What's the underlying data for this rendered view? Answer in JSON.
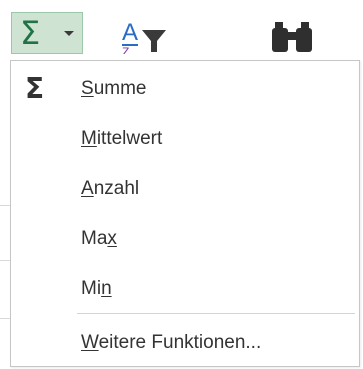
{
  "ribbon": {
    "autosum_symbol": "Σ",
    "autosum_icon": "sigma-icon",
    "sort_filter_icon": "sort-filter-icon",
    "find_icon": "binoculars-icon",
    "accent_color": "#217346"
  },
  "menu": {
    "items": [
      {
        "icon": "Σ",
        "pre": "",
        "key": "S",
        "post": "umme"
      },
      {
        "icon": "",
        "pre": "",
        "key": "M",
        "post": "ittelwert"
      },
      {
        "icon": "",
        "pre": "",
        "key": "A",
        "post": "nzahl"
      },
      {
        "icon": "",
        "pre": "Ma",
        "key": "x",
        "post": ""
      },
      {
        "icon": "",
        "pre": "Mi",
        "key": "n",
        "post": ""
      },
      {
        "icon": "",
        "pre": "",
        "key": "W",
        "post": "eitere Funktionen..."
      }
    ]
  }
}
